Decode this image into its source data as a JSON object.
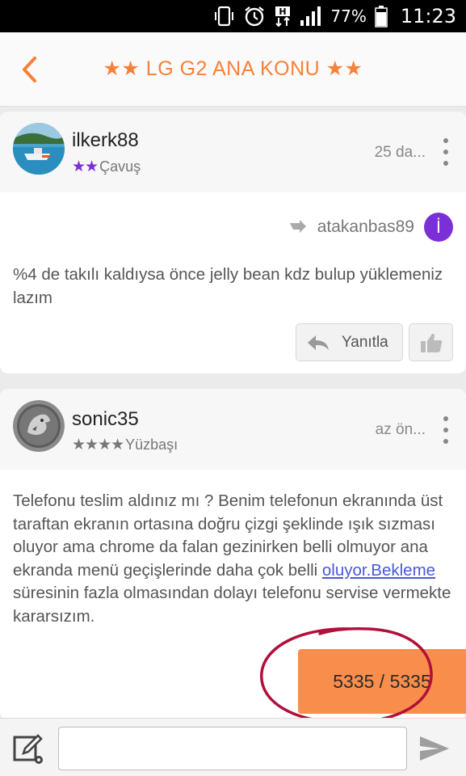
{
  "status_bar": {
    "battery_percent": "77%",
    "time": "11:23",
    "icons": [
      "phone-vibrate-icon",
      "alarm-icon",
      "h-data-icon",
      "signal-icon",
      "battery-icon"
    ]
  },
  "header": {
    "title": "★★ LG G2 ANA KONU ★★",
    "back_icon": "chevron-left-icon",
    "accent_color": "#f7813a"
  },
  "posts": [
    {
      "username": "ilkerk88",
      "rank_stars": "★★",
      "rank_name": "Çavuş",
      "rank_star_color": "#7b2fd6",
      "time": "25 da...",
      "quote": {
        "icon": "reply-arrow-icon",
        "name": "atakanbas89",
        "avatar_letter": "İ"
      },
      "text": "%4 de takılı kaldıysa önce jelly bean kdz bulup yüklemeniz lazım",
      "reply_label": "Yanıtla"
    },
    {
      "username": "sonic35",
      "rank_stars": "★★★★",
      "rank_name": "Yüzbaşı",
      "rank_star_color": "#777777",
      "time": "az ön...",
      "text_before_link": "Telefonu teslim aldınız mı ? Benim telefonun ekranında üst taraftan ekranın ortasına doğru çizgi şeklinde ışık sızması oluyor ama chrome da falan gezinirken belli olmuyor ana ekranda menü geçişlerinde daha çok belli ",
      "link_text": "oluyor.Bekleme",
      "text_after_link": " süresinin fazla olmasından dolayı telefonu servise vermekte kararsızım."
    }
  ],
  "page_counter": "5335 / 5335",
  "compose": {
    "input_value": "",
    "input_placeholder": ""
  },
  "colors": {
    "counter_bg": "#f98e4c",
    "annotation_circle": "#b0103a"
  }
}
